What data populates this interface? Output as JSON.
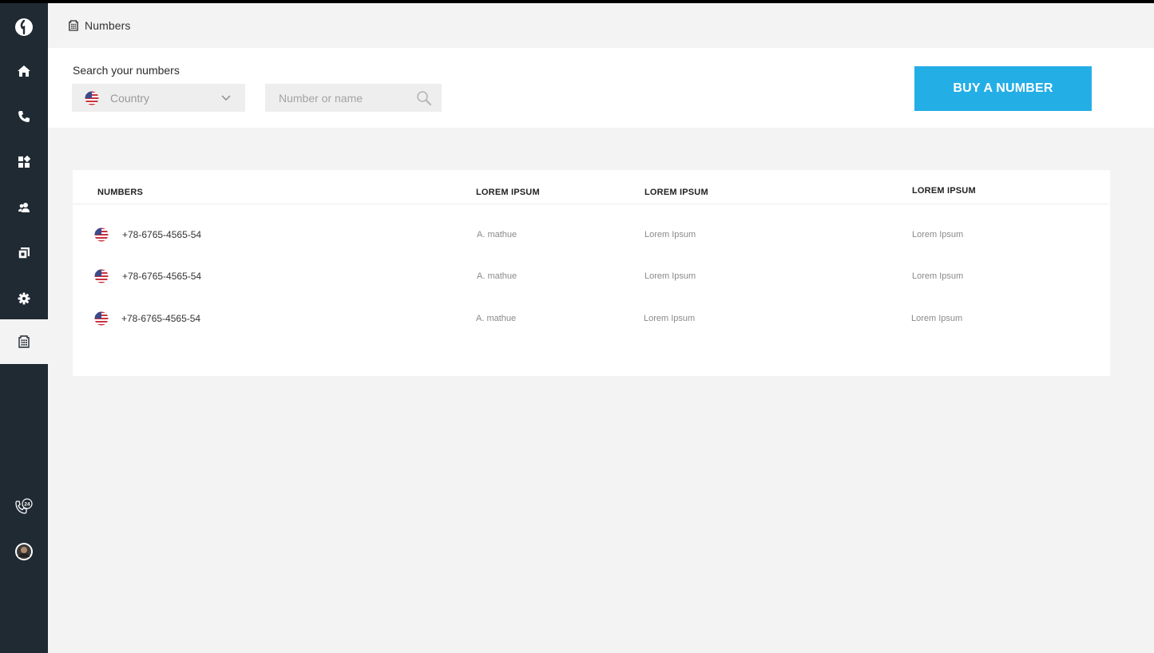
{
  "header": {
    "title": "Numbers",
    "icon": "building-icon"
  },
  "sidebar": {
    "items": [
      {
        "name": "logo-icon"
      },
      {
        "name": "home-icon"
      },
      {
        "name": "phone-icon"
      },
      {
        "name": "apps-icon"
      },
      {
        "name": "users-icon"
      },
      {
        "name": "copy-icon"
      },
      {
        "name": "settings-icon"
      },
      {
        "name": "building-icon",
        "active": true
      }
    ],
    "bottom": [
      {
        "name": "support-24-icon",
        "label": "24"
      },
      {
        "name": "avatar"
      }
    ]
  },
  "search": {
    "label": "Search your numbers",
    "country_placeholder": "Country",
    "input_placeholder": "Number or name"
  },
  "buy_button": {
    "label": "BUY A NUMBER"
  },
  "table": {
    "headers": [
      "NUMBERS",
      "LOREM IPSUM",
      "LOREM IPSUM",
      "LOREM IPSUM"
    ],
    "rows": [
      {
        "number": "+78-6765-4565-54",
        "col2": "A. mathue",
        "col3": "Lorem Ipsum",
        "col4": "Lorem Ipsum"
      },
      {
        "number": "+78-6765-4565-54",
        "col2": "A. mathue",
        "col3": "Lorem Ipsum",
        "col4": "Lorem Ipsum"
      },
      {
        "number": "+78-6765-4565-54",
        "col2": "A. mathue",
        "col3": "Lorem Ipsum",
        "col4": "Lorem Ipsum"
      }
    ]
  },
  "colors": {
    "sidebar": "#202a33",
    "accent": "#24aee6",
    "background": "#f3f3f3"
  }
}
